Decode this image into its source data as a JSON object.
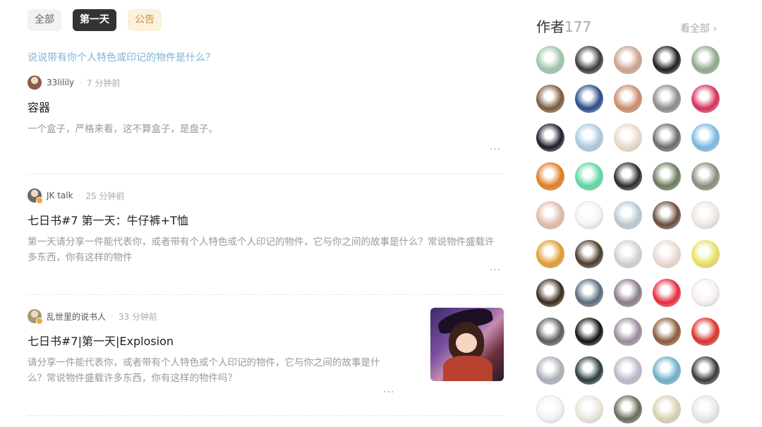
{
  "tabs": [
    {
      "label": "全部"
    },
    {
      "label": "第一天",
      "active": true
    },
    {
      "label": "公告"
    }
  ],
  "topic_question": "说说带有你个人特色或印记的物件是什么？",
  "posts": [
    {
      "author": "33lilily",
      "time": "7 分钟前",
      "title": "容器",
      "excerpt": "一个盒子，严格来看，这不算盒子，是盘子。",
      "more": "···",
      "avatar_color": "#8a5a4a"
    },
    {
      "author": "JK talk",
      "time": "25 分钟前",
      "title": "七日书#7 第一天：牛仔裤+T恤",
      "excerpt_line1": "第一天请分享一件能代表你，或者带有个人特色或个人印记的物件，它与你之间的故事是什么？常说物件盛载许",
      "excerpt_line2": "多东西，你有这样的物件",
      "more": "···",
      "avatar_color": "#6f6a5e"
    },
    {
      "author": "乱世里的说书人",
      "time": "33 分钟前",
      "title": "七日书#7|第一天|Explosion",
      "excerpt_line1": "请分享一件能代表你，或者带有个人特色或个人印记的物件，它与你之间的故事是什",
      "excerpt_line2": "么？常说物件盛载许多东西，你有这样的物件吗？",
      "more": "···",
      "avatar_color": "#a89a70"
    }
  ],
  "sidebar": {
    "title": "作者",
    "count": "177",
    "see_all": "看全部",
    "avatars": [
      "#9bc4a8",
      "#3a3a3a",
      "#c9a28a",
      "#1e1e1e",
      "#8fa88a",
      "#7a5a3a",
      "#2a4a8a",
      "#c98a6a",
      "#8a8a8a",
      "#d8305a",
      "#1a1a2a",
      "#a8c8e0",
      "#e8d8c8",
      "#6a6a6a",
      "#7ab8e0",
      "#e07a20",
      "#5ad8a0",
      "#2a2a2a",
      "#6a7a5a",
      "#8a8a7a",
      "#e0b8a8",
      "#f4f4f4",
      "#b8c8d0",
      "#6a4a3a",
      "#f0e8e0",
      "#e09a30",
      "#4a3a2a",
      "#d0d0d0",
      "#e8d8d0",
      "#e8e060",
      "#3a2a1a",
      "#5a6a7a",
      "#8a7a8a",
      "#e82a3a",
      "#f8f0f0",
      "#5a5a5a",
      "#111111",
      "#9a8a9a",
      "#8a5a3a",
      "#d8302a",
      "#a8b0b8",
      "#2a3a3a",
      "#b8b8c8",
      "#6ab0c8",
      "#3a3a3a",
      "#f0f4f8",
      "#e8e4d8",
      "#6a6a5a",
      "#d8d0b0",
      "#e8e8e8"
    ]
  }
}
